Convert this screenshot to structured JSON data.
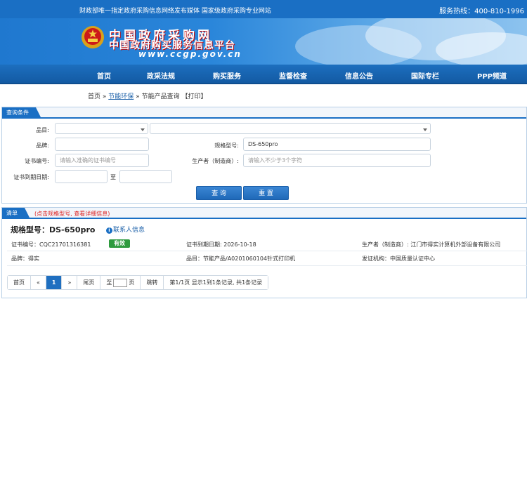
{
  "topbar": {
    "left_text": "财政部唯一指定政府采购信息网络发布媒体 国家级政府采购专业网站",
    "hotline": "服务热线：400-810-1996"
  },
  "banner": {
    "title": "中国政府采购网",
    "subtitle": "中国政府购买服务信息平台",
    "url": "www.ccgp.gov.cn"
  },
  "nav": {
    "items": [
      "首页",
      "政采法规",
      "购买服务",
      "监督检查",
      "信息公告",
      "国际专栏",
      "PPP频道"
    ]
  },
  "breadcrumb": {
    "home": "首页",
    "sep1": "»",
    "category": "节能环保",
    "sep2": "»",
    "current": "节能产品查询",
    "print": "【打印】"
  },
  "query": {
    "tab": "查询条件",
    "labels": {
      "category": "品目:",
      "brand": "品牌:",
      "model": "规格型号:",
      "cert_no": "证书编号:",
      "manufacturer": "生产者（制造商）:",
      "expiry": "证书到期日期:",
      "to": "至"
    },
    "values": {
      "model": "DS-650pro"
    },
    "placeholders": {
      "cert_no": "请输入准确的证书编号",
      "manufacturer": "请输入不少于3个字符"
    },
    "buttons": {
      "search": "查 询",
      "reset": "重 置"
    }
  },
  "list": {
    "tab": "清单",
    "hint": "(点击规格型号, 查看详细信息)",
    "record": {
      "title": "规格型号：DS-650pro",
      "contact": "联系人信息",
      "contact_icon": "info-icon",
      "cert_no": "证书编号：CQC21701316381",
      "status": "有效",
      "expiry": "证书到期日期: 2026-10-18",
      "manufacturer": "生产者（制造商）: 江门市得实计算机外部设备有限公司",
      "brand": "品牌：得实",
      "category": "品目：节能产品/A0201060104针式打印机",
      "issuer": "发证机构：中国质量认证中心"
    }
  },
  "pager": {
    "first": "首页",
    "prev": "«",
    "page": "1",
    "next": "»",
    "last": "尾页",
    "to": "至",
    "page_unit": "页",
    "jump": "跳转",
    "info": "第1/1页 显示1到1条记录, 共1条记录"
  },
  "colors": {
    "primary": "#1a6fc4",
    "status_ok": "#2e9a3e",
    "hint": "#dd2222"
  }
}
